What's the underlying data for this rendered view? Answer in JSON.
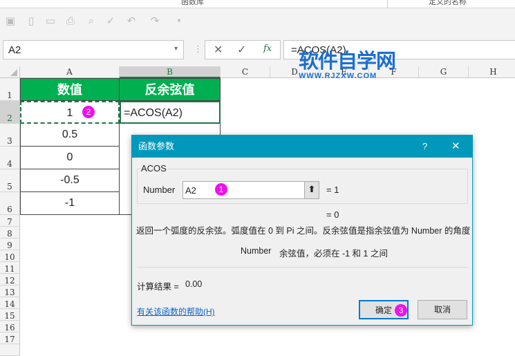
{
  "ribbon": {
    "group1": "函数库",
    "group2": "定义的名称"
  },
  "name_box": "A2",
  "formula": "=ACOS(A2)",
  "fx_label": "fx",
  "watermark": {
    "title": "软件自学网",
    "url": "WWW.RJZXW.COM"
  },
  "columns": [
    "A",
    "B",
    "C",
    "D",
    "E",
    "F",
    "G",
    "H"
  ],
  "rows": [
    "1",
    "2",
    "3",
    "4",
    "5",
    "6",
    "7",
    "8",
    "9",
    "10",
    "11",
    "12",
    "13",
    "14",
    "15",
    "16",
    "17"
  ],
  "table": {
    "headers": [
      "数值",
      "反余弦值"
    ],
    "values": [
      "1",
      "0.5",
      "0",
      "-0.5",
      "-1"
    ],
    "b2": "=ACOS(A2)"
  },
  "dialog": {
    "title": "函数参数",
    "help_q": "?",
    "close": "✕",
    "func": "ACOS",
    "arg_label": "Number",
    "arg_value": "A2",
    "arg_result": "=  1",
    "result": "=  0",
    "description": "返回一个弧度的反余弦。弧度值在 0 到 Pi 之间。反余弦值是指余弦值为 Number 的角度",
    "arg_desc_name": "Number",
    "arg_desc": "余弦值，必须在 -1 和 1 之间",
    "calc_label": "计算结果 =",
    "calc_value": "0.00",
    "help_link": "有关该函数的帮助(H)",
    "ok": "确定",
    "cancel": "取消"
  },
  "badges": [
    "1",
    "2",
    "3"
  ]
}
